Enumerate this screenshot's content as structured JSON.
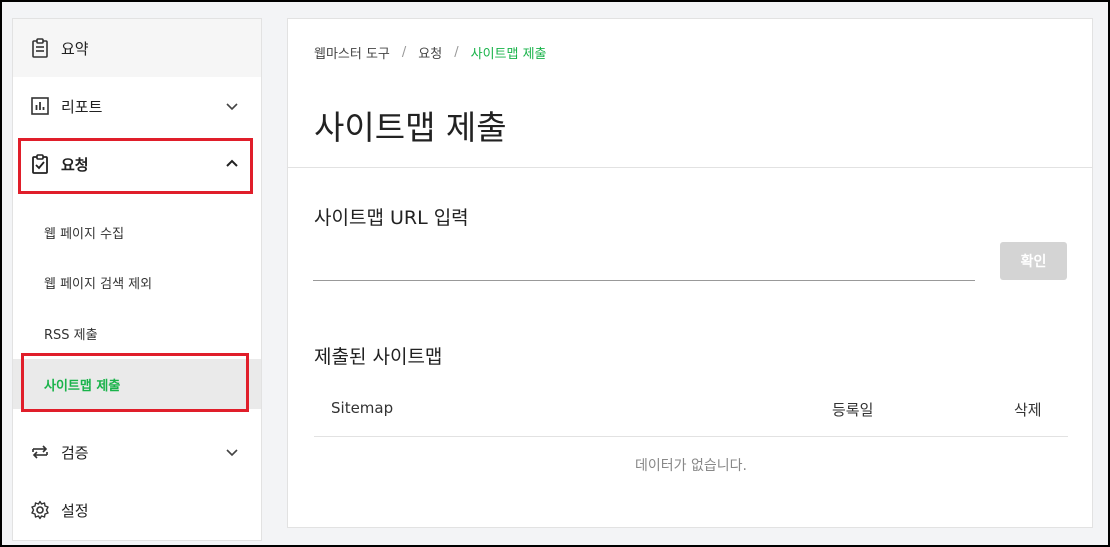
{
  "sidebar": {
    "summary": "요약",
    "report": "리포트",
    "request": "요청",
    "request_sub": [
      "웹 페이지 수집",
      "웹 페이지 검색 제외",
      "RSS 제출",
      "사이트맵 제출"
    ],
    "verify": "검증",
    "settings": "설정"
  },
  "breadcrumb": [
    "웹마스터 도구",
    "요청",
    "사이트맵 제출"
  ],
  "page_title": "사이트맵 제출",
  "url_form": {
    "label": "사이트맵 URL 입력",
    "value": "",
    "confirm_label": "확인"
  },
  "submitted": {
    "title": "제출된 사이트맵",
    "columns": [
      "Sitemap",
      "등록일",
      "삭제"
    ],
    "empty_message": "데이터가 없습니다."
  },
  "colors": {
    "accent": "#19b34a",
    "highlight_box": "#e01e2a",
    "button_disabled": "#d4d4d4"
  }
}
